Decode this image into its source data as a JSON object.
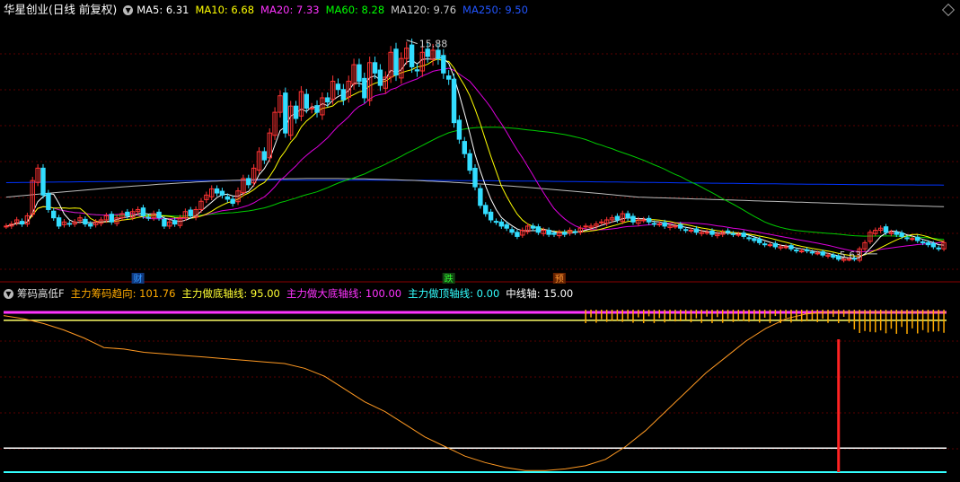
{
  "main": {
    "title": "华星创业(日线 前复权)",
    "ma": [
      {
        "label": "MA5: 6.31",
        "color": "#ffffff"
      },
      {
        "label": "MA10: 6.68",
        "color": "#ffff00"
      },
      {
        "label": "MA20: 7.33",
        "color": "#ff00ff"
      },
      {
        "label": "MA60: 8.28",
        "color": "#00ff00"
      },
      {
        "label": "MA120: 9.76",
        "color": "#cccccc"
      },
      {
        "label": "MA250: 9.50",
        "color": "#0033ff"
      }
    ],
    "high_label": "15.88",
    "low_label": "5.63",
    "markers": [
      {
        "text": "财",
        "color": "#3399ff",
        "bg": "#103a80",
        "i": 25
      },
      {
        "text": "跌",
        "color": "#33ff33",
        "bg": "#114411",
        "i": 84
      },
      {
        "text": "预",
        "color": "#ff9933",
        "bg": "#662200",
        "i": 105
      }
    ]
  },
  "sub": {
    "title": "筹码高低F",
    "items": [
      {
        "label": "主力筹码趋向: 101.76",
        "color": "#ffaa00"
      },
      {
        "label": "主力做底轴线: 95.00",
        "color": "#ffff33"
      },
      {
        "label": "主力做大底轴线: 100.00",
        "color": "#ff33ff"
      },
      {
        "label": "主力做顶轴线: 0.00",
        "color": "#33ffff"
      },
      {
        "label": "中线轴: 15.00",
        "color": "#ffffff"
      }
    ]
  },
  "chart_data": [
    {
      "type": "candlestick",
      "title": "华星创业(日线 前复权)",
      "count": 175,
      "close": [
        6.8,
        6.9,
        7.1,
        6.9,
        7.3,
        9.0,
        9.6,
        8.3,
        7.6,
        7.2,
        6.8,
        7.0,
        6.9,
        7.0,
        7.2,
        6.9,
        6.8,
        7.0,
        7.1,
        7.3,
        7.0,
        7.2,
        7.4,
        7.3,
        7.5,
        7.6,
        7.3,
        7.2,
        7.4,
        7.2,
        6.8,
        7.0,
        6.9,
        7.2,
        7.5,
        7.3,
        7.6,
        8.0,
        8.3,
        8.6,
        8.4,
        8.3,
        8.1,
        7.9,
        8.5,
        9.1,
        8.8,
        9.6,
        10.4,
        10.0,
        11.3,
        12.3,
        13.1,
        11.3,
        12.6,
        12.0,
        13.3,
        12.5,
        12.5,
        12.3,
        13.0,
        12.8,
        13.8,
        13.4,
        12.9,
        13.8,
        14.6,
        13.8,
        13.0,
        14.7,
        14.2,
        13.6,
        14.0,
        15.2,
        14.1,
        14.9,
        15.4,
        14.5,
        14.3,
        15.2,
        15.0,
        15.3,
        14.9,
        14.2,
        13.9,
        11.8,
        11.0,
        10.3,
        9.5,
        8.7,
        7.8,
        7.4,
        7.1,
        7.0,
        6.8,
        6.7,
        6.5,
        6.3,
        6.6,
        6.8,
        6.7,
        6.5,
        6.6,
        6.4,
        6.4,
        6.5,
        6.4,
        6.6,
        6.5,
        6.7,
        6.8,
        6.8,
        6.9,
        7.0,
        7.1,
        7.2,
        7.1,
        7.4,
        7.2,
        7.0,
        7.1,
        7.1,
        7.0,
        6.9,
        6.9,
        6.8,
        6.8,
        6.8,
        6.7,
        6.6,
        6.6,
        6.5,
        6.5,
        6.5,
        6.4,
        6.4,
        6.5,
        6.5,
        6.4,
        6.4,
        6.3,
        6.2,
        6.1,
        6.0,
        5.9,
        5.9,
        5.8,
        5.8,
        5.8,
        5.7,
        5.6,
        5.6,
        5.6,
        5.5,
        5.5,
        5.4,
        5.4,
        5.3,
        5.2,
        5.2,
        5.2,
        5.2,
        5.7,
        6.0,
        6.5,
        6.6,
        6.7,
        6.5,
        6.5,
        6.4,
        6.3,
        6.2,
        6.2,
        6.1,
        6.0,
        5.9,
        5.8,
        5.7,
        6.0
      ],
      "ma_series": [
        "MA5",
        "MA10",
        "MA20",
        "MA60",
        "MA120",
        "MA250"
      ],
      "high": 15.88,
      "low": 5.63
    },
    {
      "type": "line",
      "title": "筹码高低F",
      "series": [
        {
          "name": "主力筹码趋向",
          "values": [
            98,
            96,
            93,
            89,
            84,
            78,
            77,
            75,
            74,
            73,
            72,
            71,
            70,
            69,
            68,
            65,
            60,
            52,
            44,
            38,
            30,
            22,
            16,
            10,
            6,
            3,
            1,
            1,
            2,
            4,
            8,
            16,
            26,
            38,
            50,
            62,
            72,
            82,
            90,
            96,
            99,
            100,
            100,
            100,
            100,
            100,
            100,
            100
          ]
        }
      ],
      "reference_lines": [
        95,
        100,
        0,
        15
      ]
    }
  ]
}
